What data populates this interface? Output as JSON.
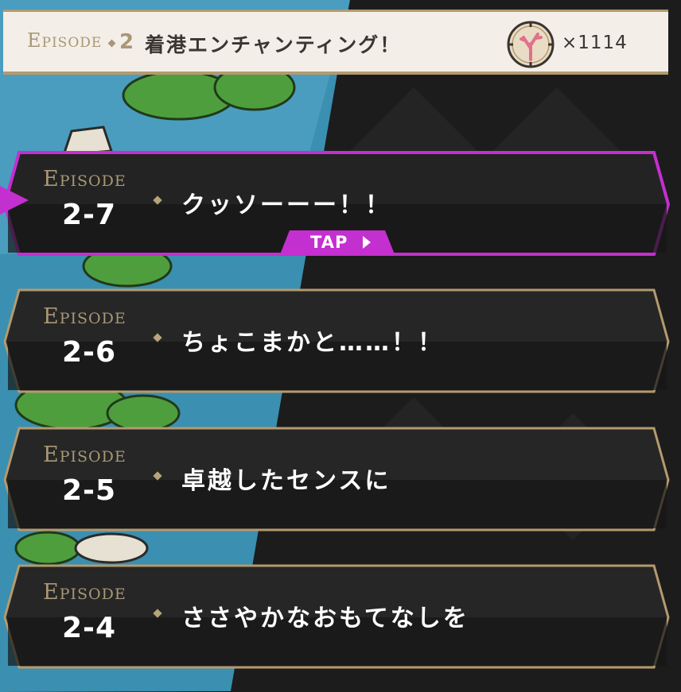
{
  "header": {
    "episode_label": "Episode",
    "episode_number": "2",
    "title": "着港エンチャンティング！",
    "currency_icon": "coral-coin-icon",
    "currency_count": "×1114"
  },
  "episodes": [
    {
      "label": "Episode",
      "number": "2-7",
      "title": "クッソーーー！！",
      "selected": true,
      "tap": "TAP"
    },
    {
      "label": "Episode",
      "number": "2-6",
      "title": "ちょこまかと……！！"
    },
    {
      "label": "Episode",
      "number": "2-5",
      "title": "卓越したセンスに"
    },
    {
      "label": "Episode",
      "number": "2-4",
      "title": "ささやかなおもてなしを"
    }
  ],
  "colors": {
    "accent_selected": "#c42fcf",
    "frame_gold": "#b49a6e",
    "panel": "#252525"
  }
}
